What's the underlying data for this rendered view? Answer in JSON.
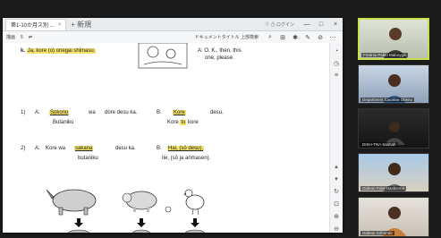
{
  "window": {
    "tab_label": "第1-10か月ス別 ...",
    "add_tab": "+ 新規",
    "hint": "① ⚠ ログイン",
    "controls": [
      "—",
      "□",
      "×"
    ]
  },
  "toolbar": {
    "items": [
      "描画",
      "5",
      "⇄"
    ],
    "right_hint": "ドキュメントタイトル 上部検索",
    "icons": [
      "search-icon",
      "zoom-icon",
      "highlight-icon",
      "draw-icon",
      "erase-icon",
      "more-icon"
    ]
  },
  "document": {
    "line_k": {
      "label": "k.",
      "text": "Ja, kore (o) onegai shimasu."
    },
    "line_k_right": {
      "a": "A: O. K., then, this",
      "b": "one, please."
    },
    "ex1": {
      "num": "1)",
      "a_label": "A:",
      "a_answer": "Sokono",
      "a_mid": "wa",
      "a_rest": "dore desu ka.",
      "a_sub": "Butaniku",
      "b_label": "B:",
      "b_answer": "Kore",
      "b_rest": "desu.",
      "b_sub_a": "Kore",
      "b_sub_b": "to",
      "b_sub_c": "kore"
    },
    "ex2": {
      "num": "2)",
      "a_label": "A:",
      "a_text": "Kore wa",
      "a_answer": "sakana",
      "a_rest": "desu ka.",
      "a_sub": "butaniku",
      "b_label": "B:",
      "b_answer": "Hai, (sō desu).",
      "b_sub": "Iie, (sō ja arimasen)."
    }
  },
  "participants": [
    {
      "name": "Frednix Pablo Maboyga"
    },
    {
      "name": "Department Caroline Otieno"
    },
    {
      "name": "DISH-TNA Sashah"
    },
    {
      "name": "Gideon Fidel Hasbiema"
    },
    {
      "name": "Gideon Sirhumbi"
    }
  ]
}
